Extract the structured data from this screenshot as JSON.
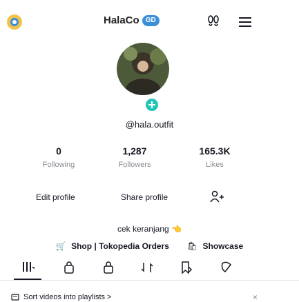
{
  "header": {
    "title": "HalaCo",
    "badge": "GD"
  },
  "profile": {
    "username": "@hala.outfit",
    "stats": [
      {
        "value": "0",
        "label": "Following"
      },
      {
        "value": "1,287",
        "label": "Followers"
      },
      {
        "value": "165.3K",
        "label": "Likes"
      }
    ],
    "edit_label": "Edit profile",
    "share_label": "Share profile",
    "bio": "cek keranjang",
    "links": [
      {
        "icon": "cart-icon",
        "label": "Shop | Tokopedia Orders"
      },
      {
        "icon": "bag-icon",
        "label": "Showcase"
      }
    ]
  },
  "footer": {
    "text": "Sort videos into playlists >"
  },
  "colors": {
    "accent": "#3b8fd9",
    "text": "#161823",
    "muted": "#8a8b91"
  }
}
